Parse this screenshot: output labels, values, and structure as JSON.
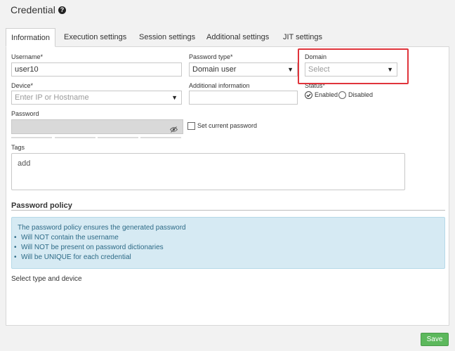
{
  "header": {
    "title": "Credential",
    "help_icon": "question-circle-icon"
  },
  "tabs": [
    {
      "label": "Information",
      "active": true
    },
    {
      "label": "Execution settings",
      "active": false
    },
    {
      "label": "Session settings",
      "active": false
    },
    {
      "label": "Additional settings",
      "active": false
    },
    {
      "label": "JIT settings",
      "active": false
    }
  ],
  "form": {
    "username": {
      "label": "Username*",
      "value": "user10"
    },
    "password_type": {
      "label": "Password type*",
      "value": "Domain user"
    },
    "domain": {
      "label": "Domain",
      "placeholder": "Select"
    },
    "device": {
      "label": "Device*",
      "placeholder": "Enter IP or Hostname"
    },
    "additional_info": {
      "label": "Additional information",
      "value": ""
    },
    "status": {
      "label": "Status*",
      "options": [
        "Enabled",
        "Disabled"
      ],
      "selected": "Enabled"
    },
    "password": {
      "label": "Password",
      "value": ""
    },
    "set_current_password": {
      "label": "Set current password",
      "checked": false
    },
    "tags": {
      "label": "Tags",
      "input": "add"
    }
  },
  "policy": {
    "title": "Password policy",
    "intro": "The password policy ensures the generated password",
    "items": [
      "Will NOT contain the username",
      "Will NOT be present on password dictionaries",
      "Will be UNIQUE for each credential"
    ]
  },
  "select_type_text": "Select type and device",
  "save_label": "Save",
  "colors": {
    "highlight": "#e0343b",
    "save": "#5cb85c",
    "policy_bg": "#d6eaf3",
    "policy_text": "#2d6a86"
  }
}
